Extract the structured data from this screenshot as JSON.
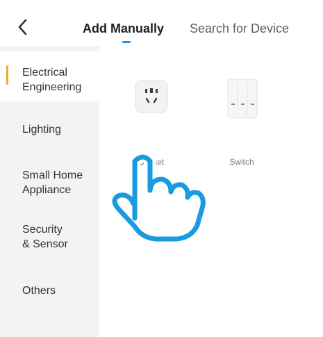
{
  "header": {
    "back_icon": "chevron-left-icon",
    "tabs": [
      {
        "label": "Add Manually",
        "active": true
      },
      {
        "label": "Search for Device",
        "active": false
      }
    ],
    "indicator_color": "#1a8ef2"
  },
  "sidebar": {
    "items": [
      {
        "label": "Electrical\nEngineering",
        "active": true
      },
      {
        "label": "Lighting",
        "active": false
      },
      {
        "label": "Small Home\nAppliance",
        "active": false
      },
      {
        "label": "Security\n& Sensor",
        "active": false
      },
      {
        "label": "Others",
        "active": false
      }
    ],
    "active_indicator_color": "#f5a623"
  },
  "devices": [
    {
      "label": "Socket",
      "icon": "socket-icon"
    },
    {
      "label": "Switch",
      "icon": "switch-icon"
    }
  ],
  "overlay": {
    "icon": "pointing-hand-icon",
    "color": "#1a9be0"
  }
}
